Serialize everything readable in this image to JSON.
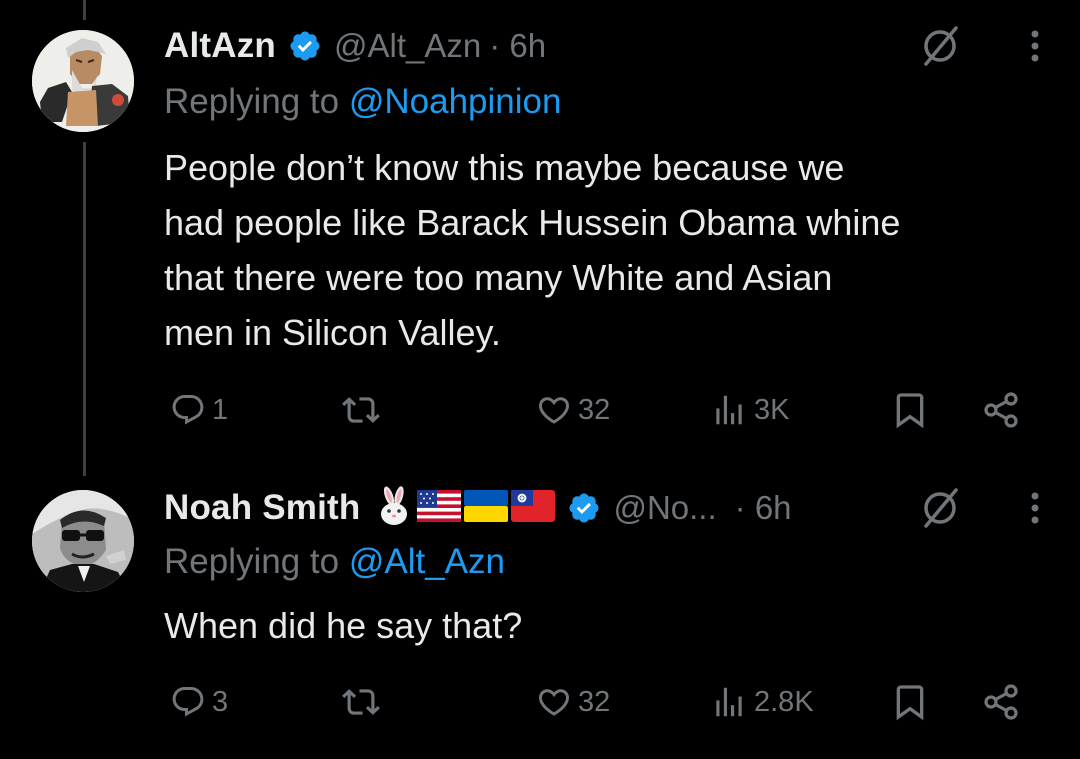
{
  "tweets": [
    {
      "display_name": "AltAzn",
      "handle": "@Alt_Azn",
      "time": "· 6h",
      "replying_prefix": "Replying to ",
      "replying_to": "@Noahpinion",
      "body_lines": [
        "People don’t know this maybe because we",
        "had people like Barack Hussein Obama whine",
        "that there were too many White and Asian",
        "men in Silicon Valley."
      ],
      "replies": "1",
      "views": "3K",
      "likes": "32"
    },
    {
      "display_name": "Noah Smith",
      "name_emojis": [
        "rabbit-emoji",
        "us-flag-emoji",
        "ukraine-flag-emoji",
        "taiwan-flag-emoji"
      ],
      "handle": "@No...",
      "time": "· 6h",
      "replying_prefix": "Replying to ",
      "replying_to": "@Alt_Azn",
      "body_lines": [
        "When did he say that?"
      ],
      "replies": "3",
      "views": "2.8K",
      "likes": "32"
    }
  ],
  "colors": {
    "background": "#000000",
    "text": "#e7e9ea",
    "secondary": "#71767b",
    "accent": "#1d9bf0"
  }
}
